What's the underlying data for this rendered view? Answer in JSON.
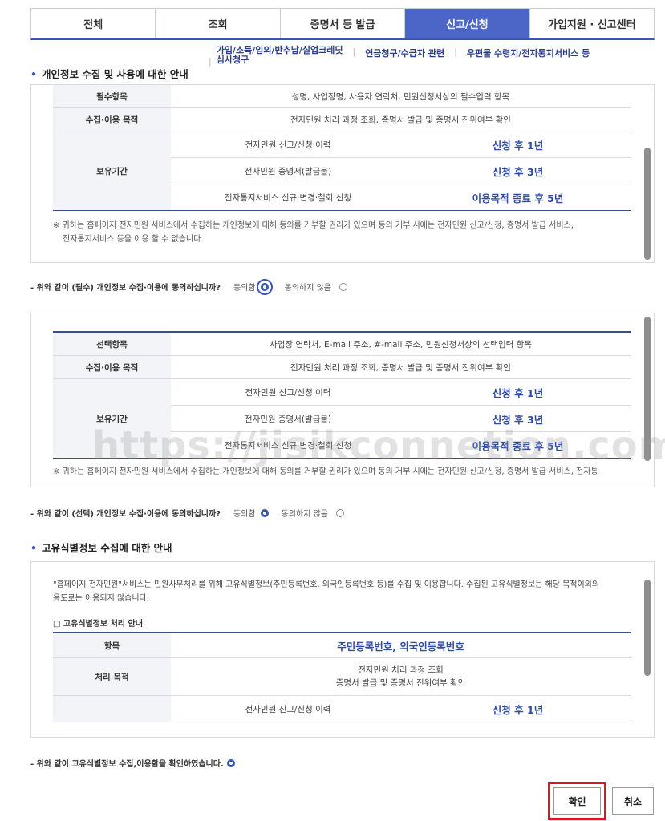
{
  "tabs": [
    {
      "label": "전체"
    },
    {
      "label": "조회"
    },
    {
      "label": "증명서 등 발급"
    },
    {
      "label": "신고/신청",
      "active": true
    },
    {
      "label": "가입지원 · 신고센터"
    }
  ],
  "sublinks": {
    "link1_line1": "가입/소득/임의/반추납/실업크레딧",
    "link1_line2": "심사청구",
    "link2": "연금청구/수급자 관련",
    "link3": "우편물 수령지/전자통지서비스 등"
  },
  "section1": {
    "title": "개인정보 수집 및 사용에 대한 안내",
    "required_table": {
      "item_header": "필수항목",
      "item_value": "성명, 사업장명, 사용자 연락처, 민원신청서상의 필수입력 항목",
      "purpose_header": "수집·이용 목적",
      "purpose_value": "전자민원 처리 과정 조회, 증명서 발급 및 증명서 진위여부 확인",
      "retention_header": "보유기간",
      "rows": [
        {
          "desc": "전자민원 신고/신청 이력",
          "period": "신청 후 1년"
        },
        {
          "desc": "전자민원 증명서(발급물)",
          "period": "신청 후 3년"
        },
        {
          "desc": "전자통지서비스 신규·변경·철회 신청",
          "period": "이용목적 종료 후 5년"
        }
      ],
      "note_line1": "※ 귀하는 홈페이지 전자민원 서비스에서 수집하는 개인정보에 대해 동의를 거부할 권리가 있으며 동의 거부 시에는 전자민원 신고/신청, 증명서 발급 서비스,",
      "note_line2": "전자통지서비스 등을 이용 할 수 없습니다."
    },
    "consent_question": "- 위와 같이 (필수) 개인정보 수집·이용에 동의하십니까?",
    "agree_label": "동의함",
    "disagree_label": "동의하지 않음"
  },
  "section2": {
    "optional_table": {
      "item_header": "선택항목",
      "item_value": "사업장 연락처, E-mail 주소, #-mail 주소, 민원신청서상의 선택입력 항목",
      "purpose_header": "수집·이용 목적",
      "purpose_value": "전자민원 처리 과정 조회, 증명서 발급 및 증명서 진위여부 확인",
      "retention_header": "보유기간",
      "rows": [
        {
          "desc": "전자민원 신고/신청 이력",
          "period": "신청 후 1년"
        },
        {
          "desc": "전자민원 증명서(발급물)",
          "period": "신청 후 3년"
        },
        {
          "desc": "전자통지서비스 신규·변경·철회 신청",
          "period": "이용목적 종료 후 5년"
        }
      ],
      "note_line1": "※ 귀하는 홈페이지 전자민원 서비스에서 수집하는 개인정보에 대해 동의를 거부할 권리가 있으며 동의 거부 시에는 전자민원 신고/신청, 증명서 발급 서비스, 전자통"
    },
    "consent_question": "- 위와 같이 (선택) 개인정보 수집·이용에 동의하십니까?",
    "agree_label": "동의함",
    "disagree_label": "동의하지 않음"
  },
  "watermark": "https://jisikconnetion.com/",
  "section3": {
    "title": "고유식별정보 수집에 대한 안내",
    "intro_line1": "\"홈페이지 전자민원\"서비스는 민원사무처리를 위해 고유식별정보(주민등록번호, 외국인등록번호 등)를 수집 및 이용합니다. 수집된 고유식별정보는 해당 목적이외의",
    "intro_line2": "용도로는 이용되지 않습니다.",
    "subheading": "□ 고유식별정보 처리 안내",
    "table": {
      "item_header": "항목",
      "item_value": "주민등록번호, 외국인등록번호",
      "purpose_header": "처리 목적",
      "purpose_line1": "전자민원 처리 과정 조회",
      "purpose_line2": "증명서 발급 및 증명서 진위여부 확인",
      "rows": [
        {
          "desc": "전자민원 신고/신청 이력",
          "period": "신청 후 1년"
        }
      ]
    },
    "confirm_question": "- 위와 같이 고유식별정보 수집,이용함을 확인하였습니다."
  },
  "buttons": {
    "confirm": "확인",
    "cancel": "취소"
  },
  "colors": {
    "accent": "#4b66c6",
    "highlight": "#e0141e",
    "value_blue": "#2e4aa8"
  }
}
